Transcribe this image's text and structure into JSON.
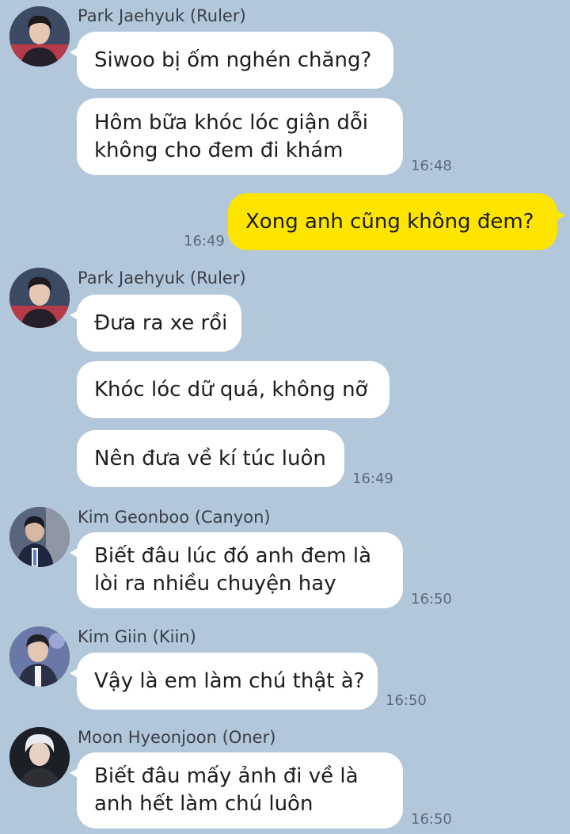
{
  "messages": {
    "ruler1": {
      "sender": "Park Jaehyuk (Ruler)",
      "b1": "Siwoo bị ốm nghén chăng?",
      "b2_line1": "Hôm bữa khóc lóc giận dỗi",
      "b2_line2": "không cho đem đi khám",
      "time": "16:48"
    },
    "me": {
      "b1": "Xong anh cũng không đem?",
      "time": "16:49"
    },
    "ruler2": {
      "sender": "Park Jaehyuk (Ruler)",
      "b1": "Đưa ra xe rồi",
      "b2": "Khóc lóc dữ quá, không nỡ",
      "b3": "Nên đưa về kí túc luôn",
      "time": "16:49"
    },
    "canyon": {
      "sender": "Kim Geonboo (Canyon)",
      "b1_line1": "Biết đâu lúc đó anh đem là",
      "b1_line2": "lòi ra nhiều chuyện hay",
      "time": "16:50"
    },
    "kiin": {
      "sender": "Kim Giin (Kiin)",
      "b1": "Vậy là em làm chú thật à?",
      "time": "16:50"
    },
    "oner": {
      "sender": "Moon Hyeonjoon (Oner)",
      "b1_line1": "Biết đâu mấy ảnh đi về là",
      "b1_line2": "anh hết làm chú luôn",
      "time": "16:50"
    }
  },
  "colors": {
    "background": "#b2c7da",
    "incoming_bubble": "#ffffff",
    "outgoing_bubble": "#fee500"
  }
}
